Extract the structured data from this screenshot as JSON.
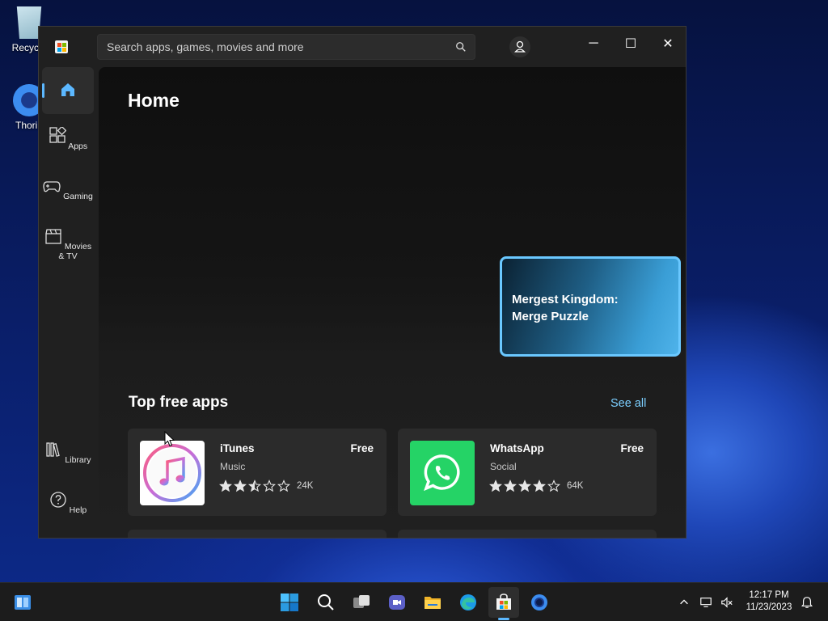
{
  "desktop": {
    "icons": [
      {
        "label": "Recycle"
      },
      {
        "label": "Thoriu"
      }
    ]
  },
  "window": {
    "search": {
      "placeholder": "Search apps, games, movies and more"
    },
    "controls": {
      "minimize": "─",
      "maximize": "☐",
      "close": "✕"
    }
  },
  "sidebar": {
    "items": [
      {
        "label": "",
        "icon": "home-icon",
        "selected": true
      },
      {
        "label": "Apps",
        "icon": "apps-icon"
      },
      {
        "label": "Gaming",
        "icon": "gamepad-icon"
      },
      {
        "label": "Movies & TV",
        "icon": "clapperboard-icon"
      },
      {
        "label": "Library",
        "icon": "library-icon"
      },
      {
        "label": "Help",
        "icon": "help-icon"
      }
    ]
  },
  "main": {
    "title": "Home",
    "promo": {
      "title": "Mergest Kingdom: Merge Puzzle"
    },
    "section": {
      "title": "Top free apps",
      "see_all": "See all"
    },
    "apps": [
      {
        "name": "iTunes",
        "category": "Music",
        "price": "Free",
        "rating": 2.5,
        "rating_count": "24K",
        "icon": "itunes-icon"
      },
      {
        "name": "WhatsApp",
        "category": "Social",
        "price": "Free",
        "rating": 4,
        "rating_count": "64K",
        "icon": "whatsapp-icon"
      }
    ]
  },
  "taskbar": {
    "icons": [
      "widgets-icon",
      "start-icon",
      "search-icon",
      "task-view-icon",
      "meet-icon",
      "file-explorer-icon",
      "edge-icon",
      "store-icon",
      "thorium-icon"
    ],
    "clock": {
      "time": "12:17 PM",
      "date": "11/23/2023"
    }
  },
  "colors": {
    "accent": "#5cb8ff",
    "link": "#7ccfff",
    "whatsapp": "#25d366"
  }
}
